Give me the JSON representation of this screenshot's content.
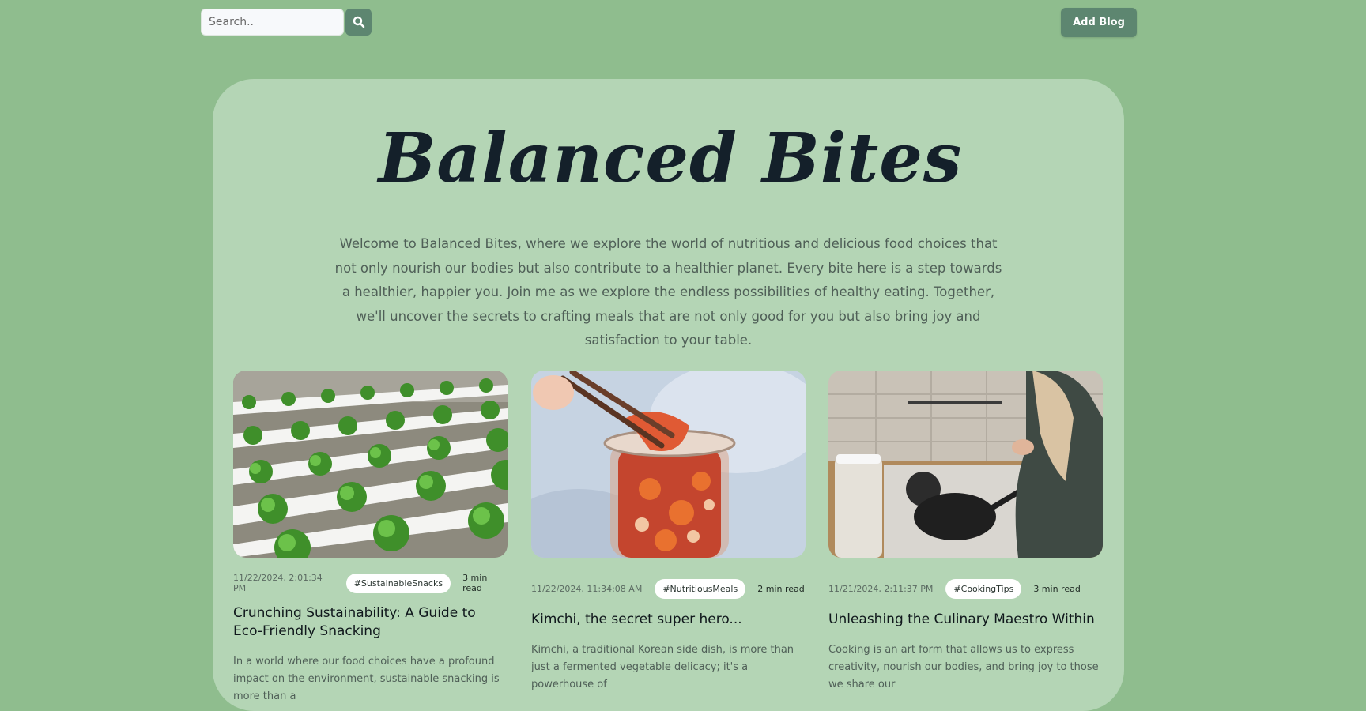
{
  "search": {
    "placeholder": "Search.."
  },
  "header": {
    "add_blog_label": "Add Blog"
  },
  "hero": {
    "title": "Balanced Bites",
    "intro": "Welcome to Balanced Bites, where we explore the world of nutritious and delicious food choices that not only nourish our bodies but also contribute to a healthier planet. Every bite here is a step towards a healthier, happier you. Join me as we explore the endless possibilities of healthy eating. Together, we'll uncover the secrets to crafting meals that are not only good for you but also bring joy and satisfaction to your table."
  },
  "posts": [
    {
      "date": "11/22/2024, 2:01:34 PM",
      "tag": "#SustainableSnacks",
      "read_time": "3 min read",
      "title": "Crunching Sustainability: A Guide to Eco-Friendly Snacking",
      "excerpt": "In a world where our food choices have a profound impact on the environment, sustainable snacking is more than a"
    },
    {
      "date": "11/22/2024, 11:34:08 AM",
      "tag": "#NutritiousMeals",
      "read_time": "2 min read",
      "title": "Kimchi, the secret super hero...",
      "excerpt": "Kimchi, a traditional Korean side dish, is more than just a fermented vegetable delicacy; it's a powerhouse of"
    },
    {
      "date": "11/21/2024, 2:11:37 PM",
      "tag": "#CookingTips",
      "read_time": "3 min read",
      "title": "Unleashing the Culinary Maestro Within",
      "excerpt": "Cooking is an art form that allows us to express creativity, nourish our bodies, and bring joy to those we share our"
    }
  ],
  "colors": {
    "page_bg": "#8fbd8e",
    "card_bg": "#b4d5b5",
    "accent": "#5d8670",
    "title": "#14202a"
  }
}
